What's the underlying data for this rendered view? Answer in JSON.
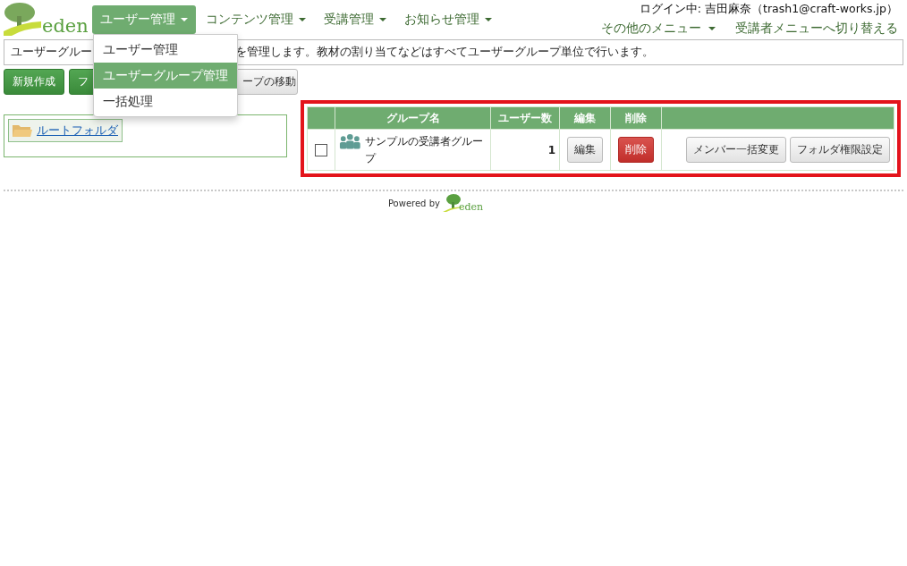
{
  "nav": [
    {
      "label": "ユーザー管理",
      "selected": true
    },
    {
      "label": "コンテンツ管理",
      "selected": false
    },
    {
      "label": "受講管理",
      "selected": false
    },
    {
      "label": "お知らせ管理",
      "selected": false
    }
  ],
  "login": "ログイン中: 吉田麻奈（trash1@craft-works.jp）",
  "top_links": [
    {
      "label": "その他のメニュー",
      "dropdown": true
    },
    {
      "label": "受講者メニューへ切り替える",
      "dropdown": false
    }
  ],
  "dropdown": [
    {
      "label": "ユーザー管理",
      "selected": false
    },
    {
      "label": "ユーザーグループ管理",
      "selected": true
    },
    {
      "label": "一括処理",
      "selected": false
    }
  ],
  "info": [
    "ユーザーグルー",
    "を管理します。教材の割り当てなどはすべてユーザーグループ単位で行います。"
  ],
  "buttons": [
    {
      "label": "新規作成",
      "kind": "primary"
    },
    {
      "label": "フ",
      "kind": "primary"
    },
    {
      "label": "ープの移動",
      "kind": "default"
    }
  ],
  "folder": {
    "label": "ルートフォルダ"
  },
  "table": {
    "columns": [
      "グループ名",
      "ユーザー数",
      "編集",
      "削除"
    ],
    "rows": [
      {
        "checked": false,
        "name": "サンプルの受講者グループ",
        "count": "1",
        "edit": "編集",
        "delete": "削除",
        "actions": [
          "メンバー一括変更",
          "フォルダ権限設定"
        ]
      }
    ]
  },
  "footer": {
    "powered": "Powered by",
    "logo": "eden"
  },
  "logo": "eden"
}
